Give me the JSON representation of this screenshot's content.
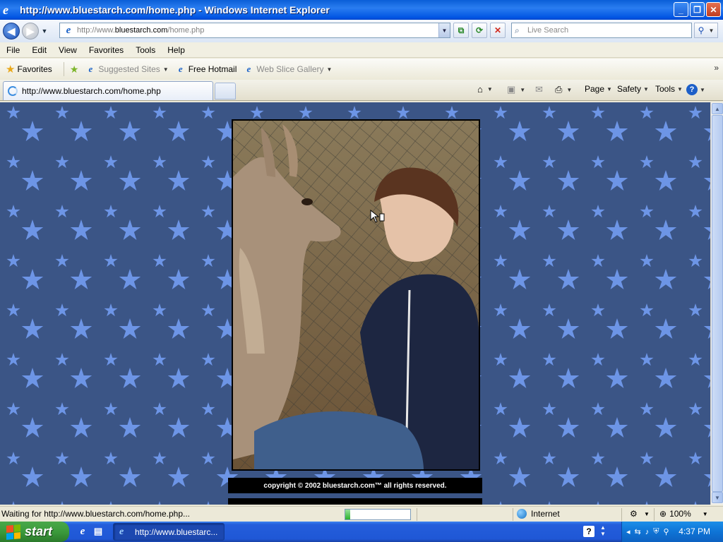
{
  "window": {
    "title": "http://www.bluestarch.com/home.php - Windows Internet Explorer",
    "minimize": "_",
    "maximize": "❐",
    "close": "✕"
  },
  "address_bar": {
    "url_prefix": "http://www.",
    "url_domain": "bluestarch.com",
    "url_path": "/home.php",
    "search_placeholder": "Live Search"
  },
  "menu": {
    "items": [
      "File",
      "Edit",
      "View",
      "Favorites",
      "Tools",
      "Help"
    ]
  },
  "favorites_bar": {
    "favorites_label": "Favorites",
    "items": [
      {
        "label": "Suggested Sites",
        "grayed": true
      },
      {
        "label": "Free Hotmail",
        "grayed": false
      },
      {
        "label": "Web Slice Gallery",
        "grayed": true
      }
    ]
  },
  "tab": {
    "label": "http://www.bluestarch.com/home.php"
  },
  "command_bar": {
    "page_label": "Page",
    "safety_label": "Safety",
    "tools_label": "Tools"
  },
  "page": {
    "copyright": "copyright © 2002 bluestarch.com™ all rights reserved.",
    "background_color": "#3b5586",
    "star_color": "#6d95e6"
  },
  "status_bar": {
    "message": "Waiting for http://www.bluestarch.com/home.php...",
    "progress": 0.08,
    "zone": "Internet",
    "zoom": "100%"
  },
  "taskbar": {
    "start_label": "start",
    "task_label": "http://www.bluestarc...",
    "clock": "4:37 PM"
  }
}
